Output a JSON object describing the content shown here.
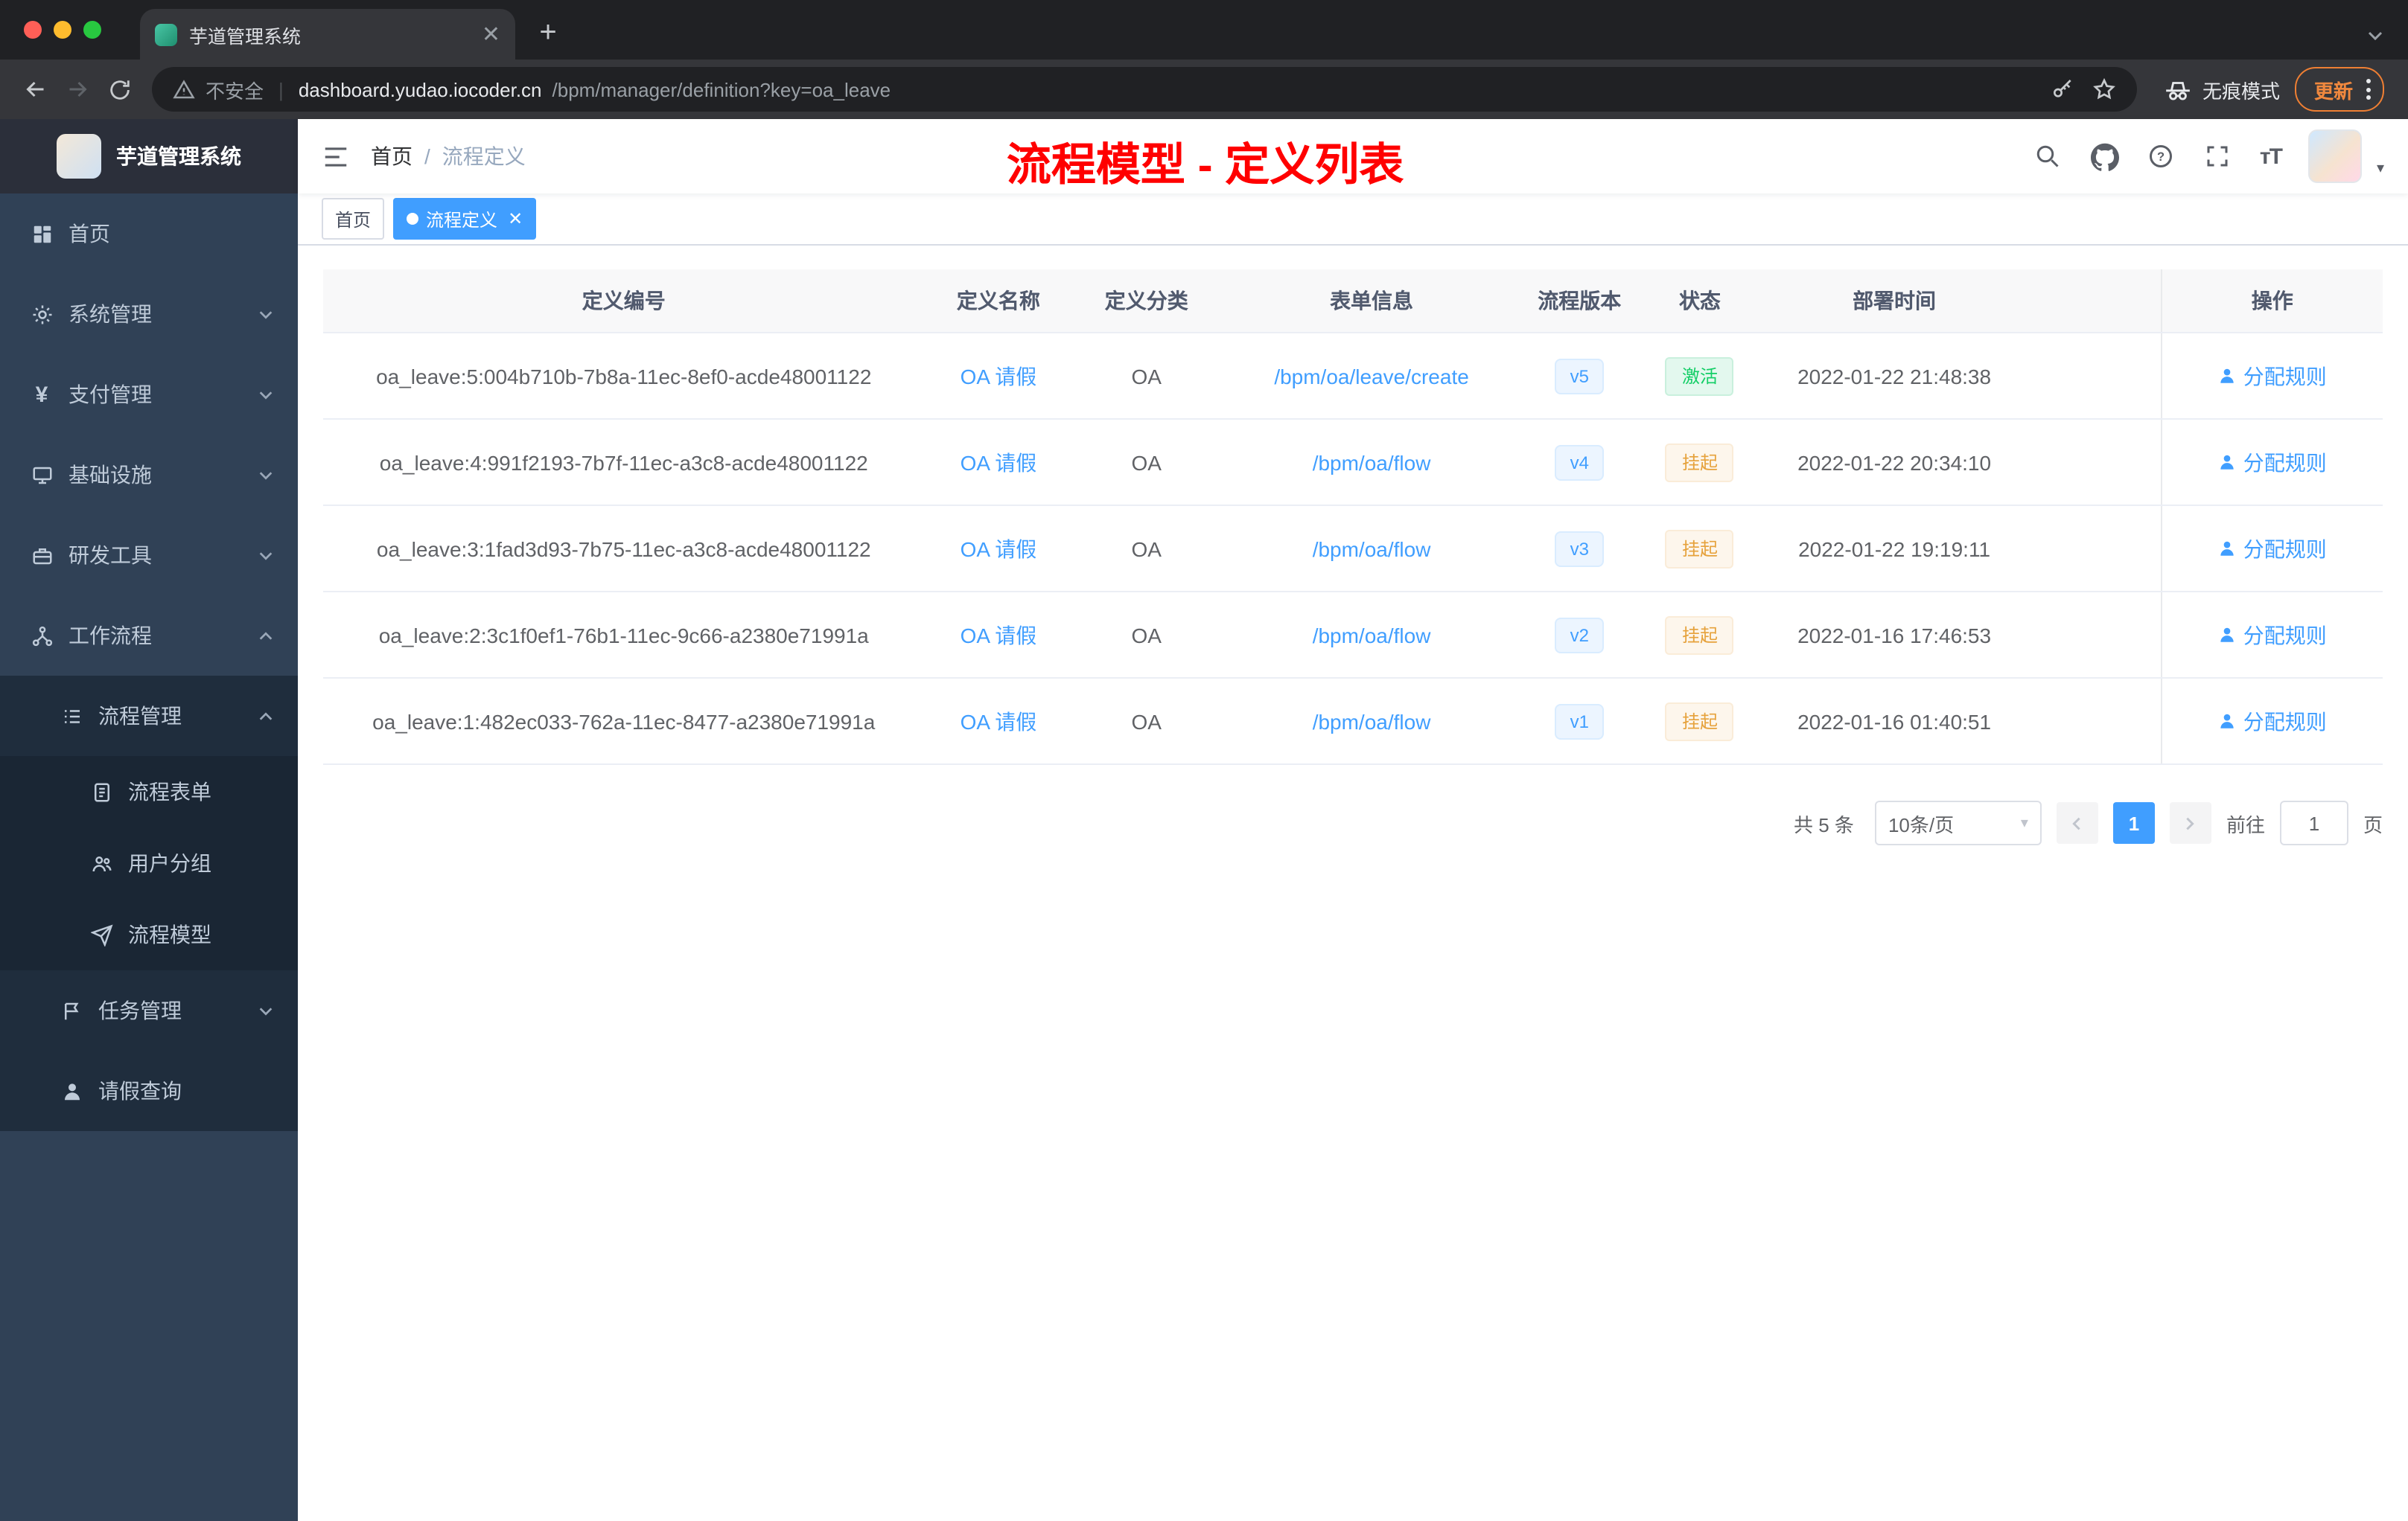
{
  "browser": {
    "tab_title": "芋道管理系统",
    "new_tab_label": "+",
    "security_label": "不安全",
    "url_host": "dashboard.yudao.iocoder.cn",
    "url_path": "/bpm/manager/definition?key=oa_leave",
    "incognito_label": "无痕模式",
    "update_label": "更新"
  },
  "sidebar": {
    "logo_title": "芋道管理系统",
    "items": [
      {
        "label": "首页"
      },
      {
        "label": "系统管理"
      },
      {
        "label": "支付管理"
      },
      {
        "label": "基础设施"
      },
      {
        "label": "研发工具"
      },
      {
        "label": "工作流程"
      },
      {
        "label": "流程管理"
      },
      {
        "label": "流程表单"
      },
      {
        "label": "用户分组"
      },
      {
        "label": "流程模型"
      },
      {
        "label": "任务管理"
      },
      {
        "label": "请假查询"
      }
    ]
  },
  "header": {
    "breadcrumb": [
      "首页",
      "流程定义"
    ],
    "breadcrumb_separator": "/",
    "annotation": "流程模型 - 定义列表",
    "fontsize_icon_text": "тT"
  },
  "tags": [
    {
      "label": "首页"
    },
    {
      "label": "流程定义"
    }
  ],
  "table": {
    "columns": [
      "定义编号",
      "定义名称",
      "定义分类",
      "表单信息",
      "流程版本",
      "状态",
      "部署时间",
      "操作"
    ],
    "rows": [
      {
        "id": "oa_leave:5:004b710b-7b8a-11ec-8ef0-acde48001122",
        "name": "OA 请假",
        "category": "OA",
        "form": "/bpm/oa/leave/create",
        "version": "v5",
        "status": "激活",
        "time": "2022-01-22 21:48:38",
        "action": "分配规则"
      },
      {
        "id": "oa_leave:4:991f2193-7b7f-11ec-a3c8-acde48001122",
        "name": "OA 请假",
        "category": "OA",
        "form": "/bpm/oa/flow",
        "version": "v4",
        "status": "挂起",
        "time": "2022-01-22 20:34:10",
        "action": "分配规则"
      },
      {
        "id": "oa_leave:3:1fad3d93-7b75-11ec-a3c8-acde48001122",
        "name": "OA 请假",
        "category": "OA",
        "form": "/bpm/oa/flow",
        "version": "v3",
        "status": "挂起",
        "time": "2022-01-22 19:19:11",
        "action": "分配规则"
      },
      {
        "id": "oa_leave:2:3c1f0ef1-76b1-11ec-9c66-a2380e71991a",
        "name": "OA 请假",
        "category": "OA",
        "form": "/bpm/oa/flow",
        "version": "v2",
        "status": "挂起",
        "time": "2022-01-16 17:46:53",
        "action": "分配规则"
      },
      {
        "id": "oa_leave:1:482ec033-762a-11ec-8477-a2380e71991a",
        "name": "OA 请假",
        "category": "OA",
        "form": "/bpm/oa/flow",
        "version": "v1",
        "status": "挂起",
        "time": "2022-01-16 01:40:51",
        "action": "分配规则"
      }
    ]
  },
  "pagination": {
    "total": "共 5 条",
    "page_size": "10条/页",
    "current_page": "1",
    "goto_label": "前往",
    "goto_value": "1",
    "page_unit": "页"
  },
  "colors": {
    "accent": "#409eff",
    "annotation": "#ff0000",
    "status_active": "#13ce66",
    "status_suspended": "#e6a23c",
    "sidebar_bg": "#304156"
  }
}
